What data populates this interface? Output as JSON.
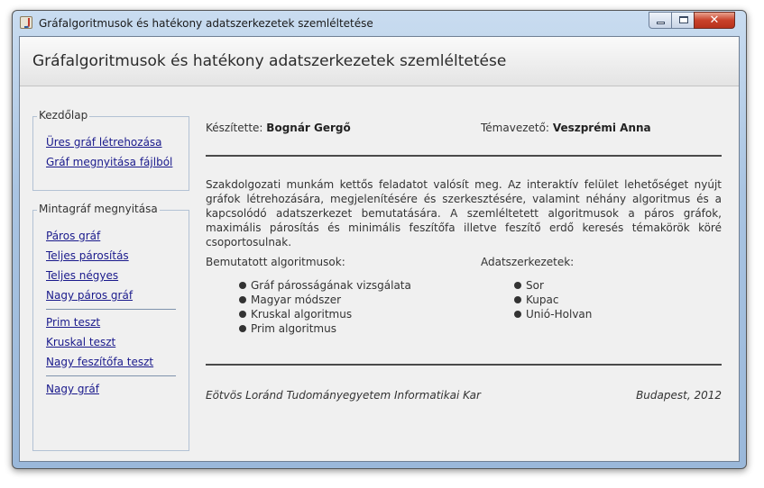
{
  "window": {
    "title": "Gráfalgoritmusok és hatékony adatszerkezetek szemléltetése",
    "close_glyph": "✕"
  },
  "header": {
    "title": "Gráfalgoritmusok és hatékony adatszerkezetek szemléltetése"
  },
  "sidebar": {
    "home": {
      "legend": "Kezdőlap",
      "links": [
        "Üres gráf létrehozása",
        "Gráf megnyitása fájlból"
      ]
    },
    "samples": {
      "legend": "Mintagráf megnyitása",
      "groups": [
        [
          "Páros gráf",
          "Teljes párosítás",
          "Teljes négyes",
          "Nagy páros gráf"
        ],
        [
          "Prim teszt",
          "Kruskal teszt",
          "Nagy feszítőfa teszt"
        ],
        [
          "Nagy gráf"
        ]
      ]
    }
  },
  "main": {
    "author_label": "Készítette:",
    "author": "Bognár Gergő",
    "supervisor_label": "Témavezető:",
    "supervisor": "Veszprémi Anna",
    "description": "Szakdolgozati munkám kettős feladatot valósít meg. Az interaktív felület lehetőséget nyújt gráfok létrehozására, megjelenítésére és szerkesztésére, valamint néhány algoritmus és a kapcsolódó adatszerkezet bemutatására. A szemléltetett algoritmusok a páros gráfok, maximális párosítás és minimális feszítőfa illetve feszítő erdő keresés témakörök köré csoportosulnak.",
    "algorithms_title": "Bemutatott algoritmusok:",
    "algorithms": [
      "Gráf párosságának vizsgálata",
      "Magyar módszer",
      "Kruskal algoritmus",
      "Prim algoritmus"
    ],
    "structures_title": "Adatszerkezetek:",
    "structures": [
      "Sor",
      "Kupac",
      "Unió-Holvan"
    ],
    "footer_left": "Eötvös Loránd Tudományegyetem Informatikai Kar",
    "footer_right": "Budapest, 2012"
  }
}
